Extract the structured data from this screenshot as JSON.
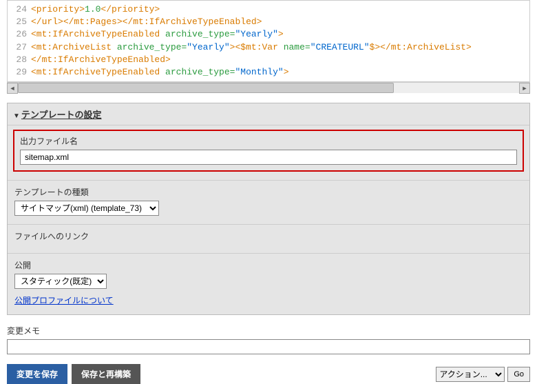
{
  "code": {
    "lines": [
      {
        "num": 24,
        "segments": [
          {
            "text": "<priority>",
            "cls": "c-orange"
          },
          {
            "text": "1.0",
            "cls": "c-green"
          },
          {
            "text": "</priority>",
            "cls": "c-orange"
          }
        ]
      },
      {
        "num": 25,
        "segments": [
          {
            "text": "</url>",
            "cls": "c-orange"
          },
          {
            "text": "</mt:Pages>",
            "cls": "c-orange"
          },
          {
            "text": "</mt:IfArchiveTypeEnabled>",
            "cls": "c-orange"
          }
        ]
      },
      {
        "num": 26,
        "segments": [
          {
            "text": "<mt:IfArchiveTypeEnabled ",
            "cls": "c-orange"
          },
          {
            "text": "archive_type=",
            "cls": "c-green"
          },
          {
            "text": "\"Yearly\"",
            "cls": "c-blue"
          },
          {
            "text": ">",
            "cls": "c-orange"
          }
        ]
      },
      {
        "num": 27,
        "segments": [
          {
            "text": "<mt:ArchiveList ",
            "cls": "c-orange"
          },
          {
            "text": "archive_type=",
            "cls": "c-green"
          },
          {
            "text": "\"Yearly\"",
            "cls": "c-blue"
          },
          {
            "text": ">",
            "cls": "c-orange"
          },
          {
            "text": "<$mt:Var ",
            "cls": "c-orange"
          },
          {
            "text": "name=",
            "cls": "c-green"
          },
          {
            "text": "\"CREATEURL\"",
            "cls": "c-blue"
          },
          {
            "text": "$>",
            "cls": "c-orange"
          },
          {
            "text": "</mt:ArchiveList>",
            "cls": "c-orange"
          }
        ]
      },
      {
        "num": 28,
        "segments": [
          {
            "text": "</mt:IfArchiveTypeEnabled>",
            "cls": "c-orange"
          }
        ]
      },
      {
        "num": 29,
        "segments": [
          {
            "text": "<mt:IfArchiveTypeEnabled ",
            "cls": "c-orange"
          },
          {
            "text": "archive_type=",
            "cls": "c-green"
          },
          {
            "text": "\"Monthly\"",
            "cls": "c-blue"
          },
          {
            "text": ">",
            "cls": "c-orange"
          }
        ]
      }
    ]
  },
  "panel": {
    "title": "テンプレートの設定",
    "output_file": {
      "label": "出力ファイル名",
      "value": "sitemap.xml"
    },
    "template_type": {
      "label": "テンプレートの種類",
      "selected": "サイトマップ(xml) (template_73)"
    },
    "file_link": {
      "label": "ファイルへのリンク"
    },
    "publish": {
      "label": "公開",
      "selected": "スタティック(既定)",
      "link": "公開プロファイルについて"
    }
  },
  "memo": {
    "label": "変更メモ",
    "value": ""
  },
  "buttons": {
    "save": "変更を保存",
    "rebuild": "保存と再構築",
    "action_selected": "アクション...",
    "go": "Go"
  }
}
